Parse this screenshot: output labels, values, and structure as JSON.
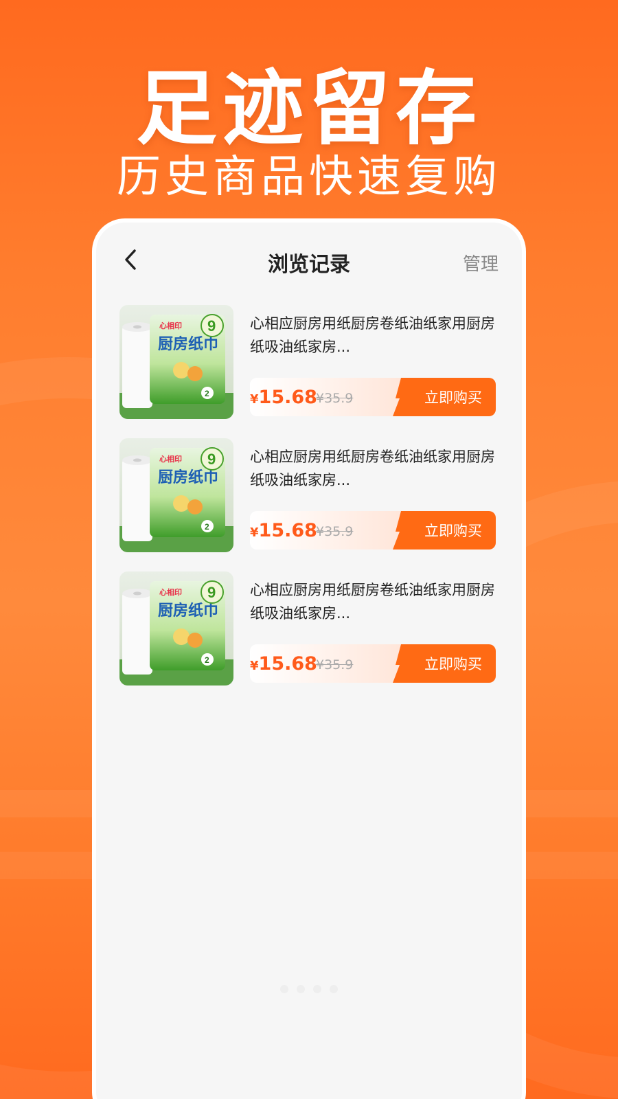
{
  "hero": {
    "title": "足迹留存",
    "subtitle": "历史商品快速复购"
  },
  "nav": {
    "title": "浏览记录",
    "manage": "管理"
  },
  "products": [
    {
      "name": "心相应厨房用纸厨房卷纸油纸家用厨房纸吸油纸家房...",
      "currency": "¥",
      "price": "15.68",
      "original_price": "¥35.9",
      "buy_label": "立即购买",
      "thumb_brand": "心相印",
      "thumb_title": "厨房纸巾",
      "thumb_badge": "9",
      "thumb_count": "2"
    },
    {
      "name": "心相应厨房用纸厨房卷纸油纸家用厨房纸吸油纸家房...",
      "currency": "¥",
      "price": "15.68",
      "original_price": "¥35.9",
      "buy_label": "立即购买",
      "thumb_brand": "心相印",
      "thumb_title": "厨房纸巾",
      "thumb_badge": "9",
      "thumb_count": "2"
    },
    {
      "name": "心相应厨房用纸厨房卷纸油纸家用厨房纸吸油纸家房...",
      "currency": "¥",
      "price": "15.68",
      "original_price": "¥35.9",
      "buy_label": "立即购买",
      "thumb_brand": "心相印",
      "thumb_title": "厨房纸巾",
      "thumb_badge": "9",
      "thumb_count": "2"
    }
  ],
  "colors": {
    "accent": "#ff6a14",
    "price": "#ff5a1a",
    "background_orange": "#ff7d2e"
  }
}
